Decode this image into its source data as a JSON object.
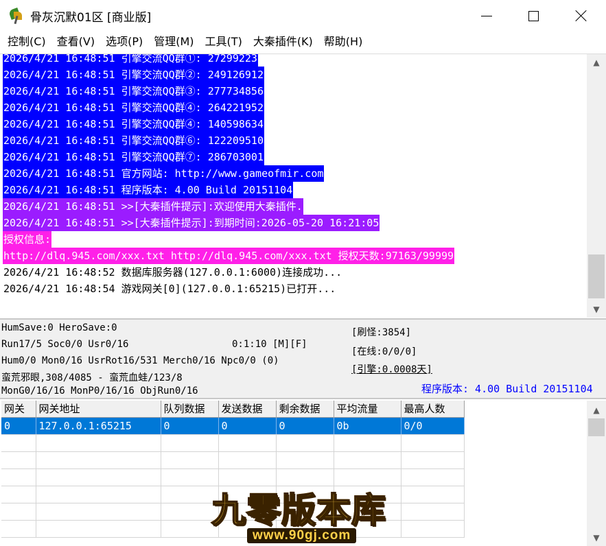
{
  "window": {
    "title": "骨灰沉默01区 [商业版]",
    "icon": "app-icon"
  },
  "menu": [
    "控制(C)",
    "查看(V)",
    "选项(P)",
    "管理(M)",
    "工具(T)",
    "大秦插件(K)",
    "帮助(H)"
  ],
  "log": [
    {
      "text": "2026/4/21 16:48:51 引擎交流QQ群①: 27299223",
      "style": "blue"
    },
    {
      "text": "2026/4/21 16:48:51 引擎交流QQ群②: 249126912",
      "style": "blue"
    },
    {
      "text": "2026/4/21 16:48:51 引擎交流QQ群③: 277734856",
      "style": "blue"
    },
    {
      "text": "2026/4/21 16:48:51 引擎交流QQ群④: 264221952",
      "style": "blue"
    },
    {
      "text": "2026/4/21 16:48:51 引擎交流QQ群④: 140598634",
      "style": "blue"
    },
    {
      "text": "2026/4/21 16:48:51 引擎交流QQ群⑥: 122209510",
      "style": "blue"
    },
    {
      "text": "2026/4/21 16:48:51 引擎交流QQ群⑦: 286703001",
      "style": "blue"
    },
    {
      "text": "2026/4/21 16:48:51 官方网站: http://www.gameofmir.com",
      "style": "blue"
    },
    {
      "text": "2026/4/21 16:48:51 程序版本: 4.00 Build 20151104",
      "style": "blue"
    },
    {
      "text": "2026/4/21 16:48:51 >>[大秦插件提示]:欢迎使用大秦插件.",
      "style": "purple"
    },
    {
      "text": "2026/4/21 16:48:51 >>[大秦插件提示]:到期时间:2026-05-20 16:21:05",
      "style": "purple"
    },
    {
      "text": "授权信息:",
      "style": "magenta"
    },
    {
      "text": "http://dlq.945.com/xxx.txt http://dlq.945.com/xxx.txt 授权天数:97163/99999",
      "style": "magenta"
    },
    {
      "text": "2026/4/21 16:48:52 数据库服务器(127.0.0.1:6000)连接成功...",
      "style": "plain"
    },
    {
      "text": "2026/4/21 16:48:54 游戏网关[0](127.0.0.1:65215)已打开...",
      "style": "plain"
    }
  ],
  "status": {
    "line1": "HumSave:0 HeroSave:0",
    "line2": "Run17/5 Soc0/0 Usr0/16",
    "timer": "0:1:10 [M][F]",
    "line3": "Hum0/0 Mon0/16 UsrRot16/531 Merch0/16 Npc0/0 (0)",
    "line4": "蛮荒邪眼,308/4085 - 蛮荒血蛙/123/8",
    "line5": "MonG0/16/16 MonP0/16/16 ObjRun0/16",
    "refresh": "[刷怪:3854]",
    "online": "[在线:0/0/0]",
    "engine": "[引擎:0.0008天]",
    "version": "程序版本: 4.00 Build 20151104"
  },
  "grid": {
    "columns": [
      "网关",
      "网关地址",
      "队列数据",
      "发送数据",
      "剩余数据",
      "平均流量",
      "最高人数"
    ],
    "rows": [
      [
        "0",
        "127.0.0.1:65215",
        "0",
        "0",
        "0",
        "0b",
        "0/0"
      ]
    ],
    "empty_rows": 6
  },
  "watermark": {
    "logo_text": "九零版本库",
    "url": "www.90gj.com"
  },
  "colors": {
    "log_blue": "#0000ff",
    "log_purple": "#9b1cff",
    "log_magenta": "#ff20e8",
    "selection": "#0078d7",
    "version_text": "#0000ff"
  }
}
